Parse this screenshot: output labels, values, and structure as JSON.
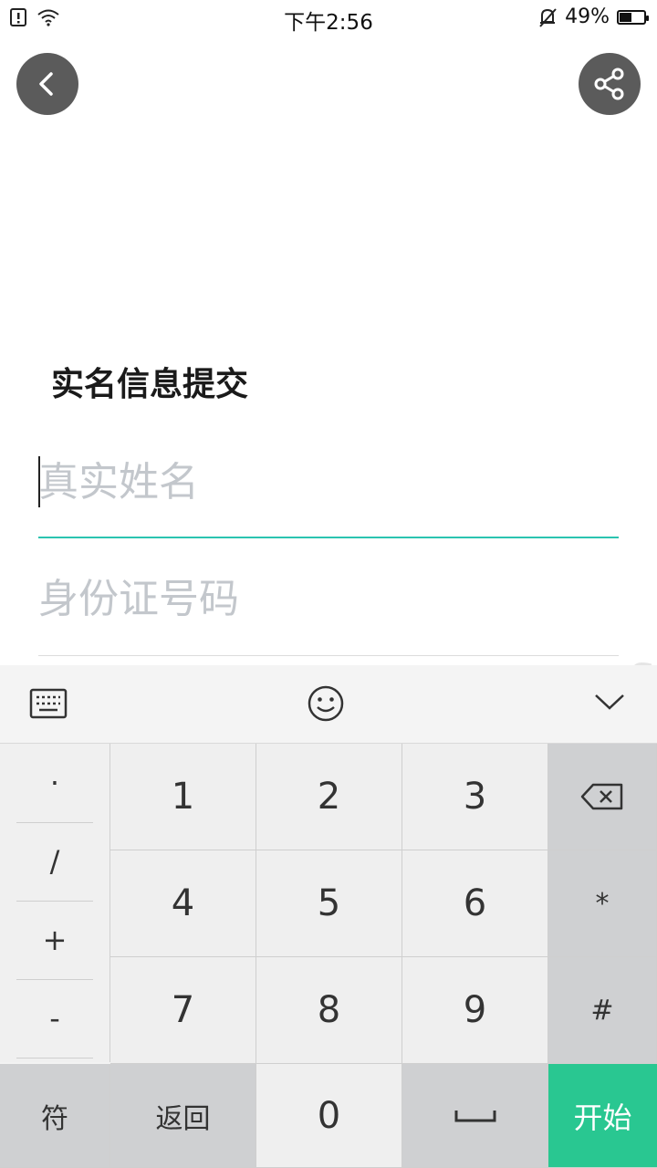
{
  "status": {
    "time": "下午2:56",
    "battery": "49%",
    "battery_level": 0.49
  },
  "header": {
    "back_icon": "chevron-left-icon",
    "share_icon": "share-icon"
  },
  "form": {
    "title": "实名信息提交",
    "name_placeholder": "真实姓名",
    "id_placeholder": "身份证号码"
  },
  "keyboard": {
    "toolbar": {
      "keyboard_icon": "keyboard-icon",
      "emoji_icon": "smiley-icon",
      "collapse_icon": "chevron-down-icon"
    },
    "symbols": [
      "·",
      "/",
      "+",
      "-"
    ],
    "digits": {
      "k1": "1",
      "k2": "2",
      "k3": "3",
      "k4": "4",
      "k5": "5",
      "k6": "6",
      "k7": "7",
      "k8": "8",
      "k9": "9",
      "k0": "0"
    },
    "star": "*",
    "hash": "#",
    "symbols_key": "符",
    "return_key": "返回",
    "space_icon": "space-bar-icon",
    "start_key": "开始",
    "backspace_icon": "backspace-icon"
  },
  "colors": {
    "accent_underline": "#2bc4b0",
    "start_key": "#29c791"
  }
}
